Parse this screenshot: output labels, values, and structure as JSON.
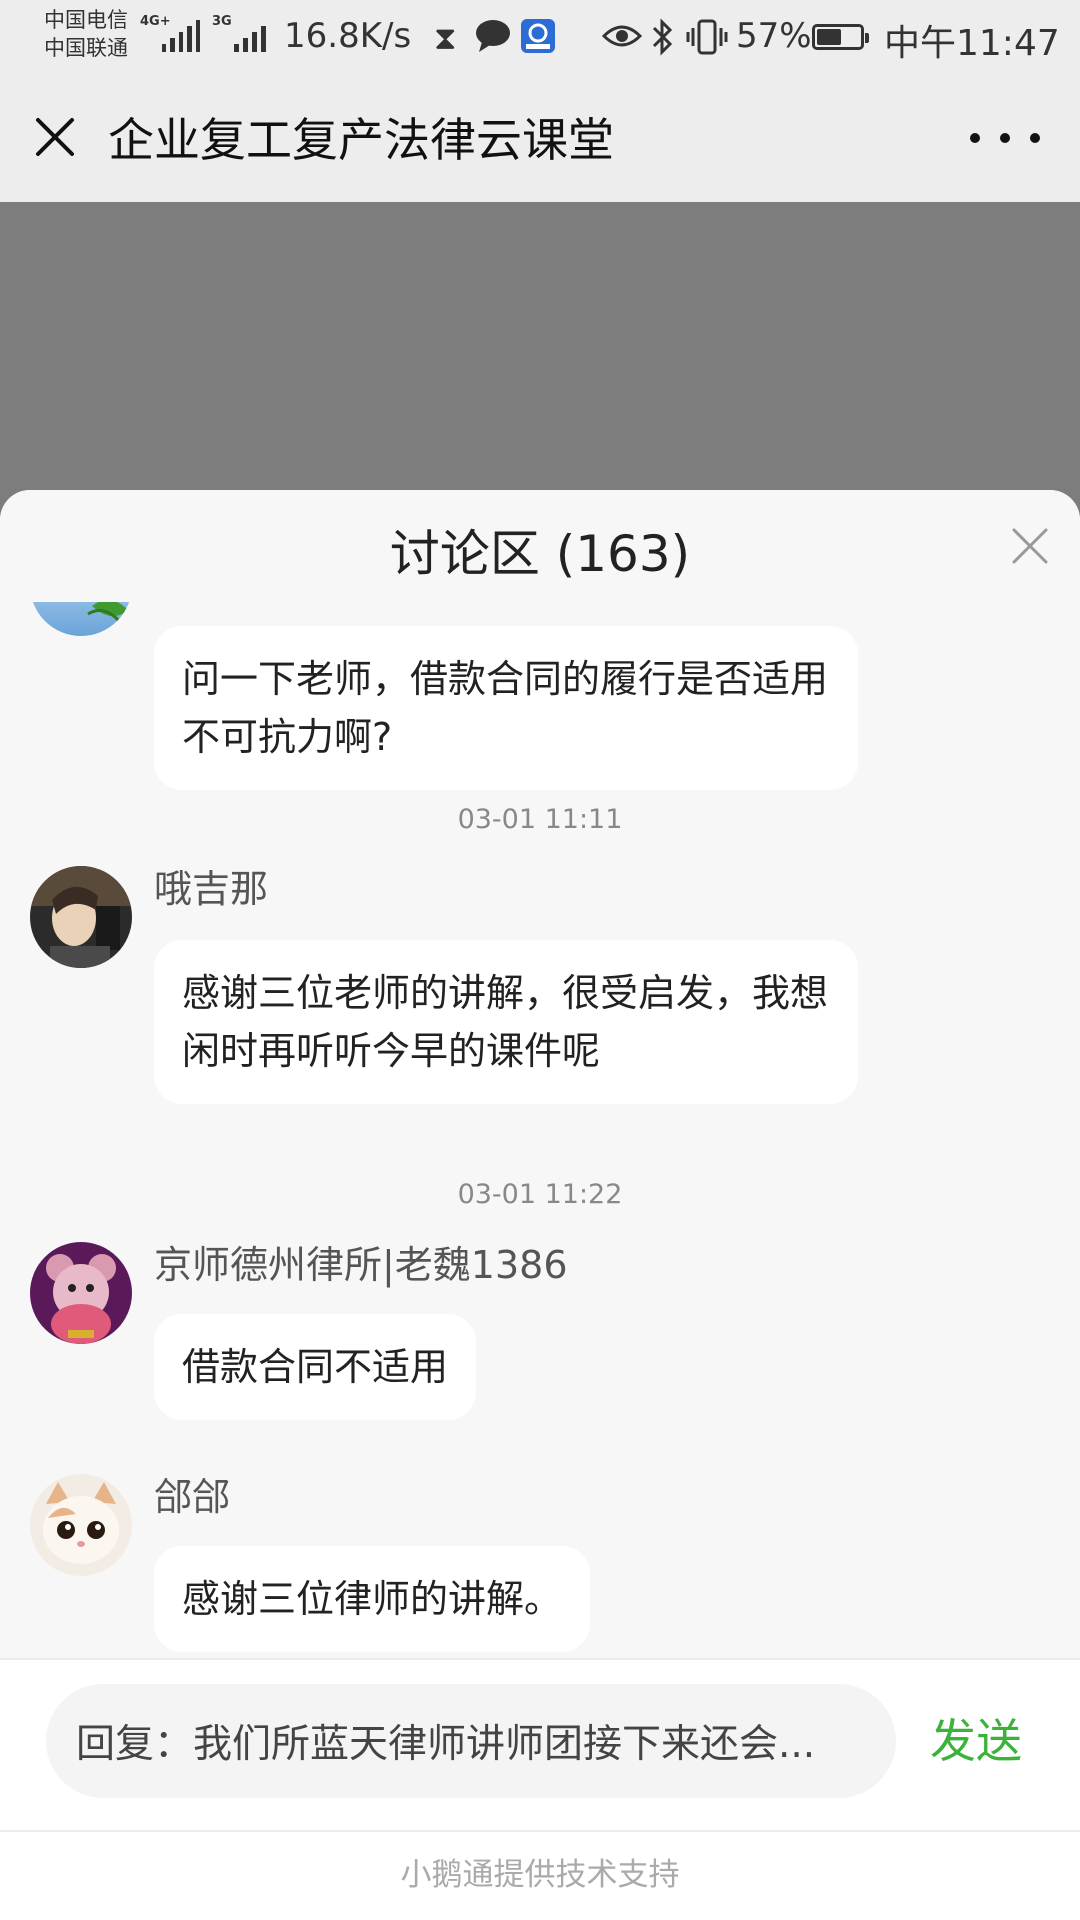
{
  "status_bar": {
    "carrier_1": "中国电信",
    "carrier_2": "中国联通",
    "network_1": "4G+",
    "network_2": "3G",
    "speed": "16.8K/s",
    "battery_percent_text": "57%",
    "battery_level": 0.57,
    "time": "中午11:47",
    "icons": [
      "hourglass-icon",
      "chat-bubble-icon",
      "app-badge-icon",
      "eye-icon",
      "bluetooth-icon",
      "vibrate-icon",
      "battery-icon"
    ]
  },
  "nav": {
    "title": "企业复工复产法律云课堂"
  },
  "discussion": {
    "title": "讨论区 (163)",
    "messages": [
      {
        "text": "问一下老师，借款合同的履行是否适用不可抗力啊?"
      },
      {
        "time": "03-01 11:11",
        "name": "哦吉那",
        "text": "感谢三位老师的讲解，很受启发，我想闲时再听听今早的课件呢"
      },
      {
        "time": "03-01 11:22",
        "name": "京师德州律所|老魏1386",
        "text": "借款合同不适用"
      },
      {
        "name": "郃郃",
        "text": "感谢三位律师的讲解。"
      }
    ]
  },
  "reply": {
    "value": "回复：我们所蓝天律师讲师团接下来还会...",
    "send_label": "发送"
  },
  "footer": {
    "powered_by": "小鹅通提供技术支持"
  },
  "colors": {
    "send_green": "#3bb33b",
    "sheet_background": "#f7f7f7",
    "overlay_gray": "#7d7d7d"
  }
}
